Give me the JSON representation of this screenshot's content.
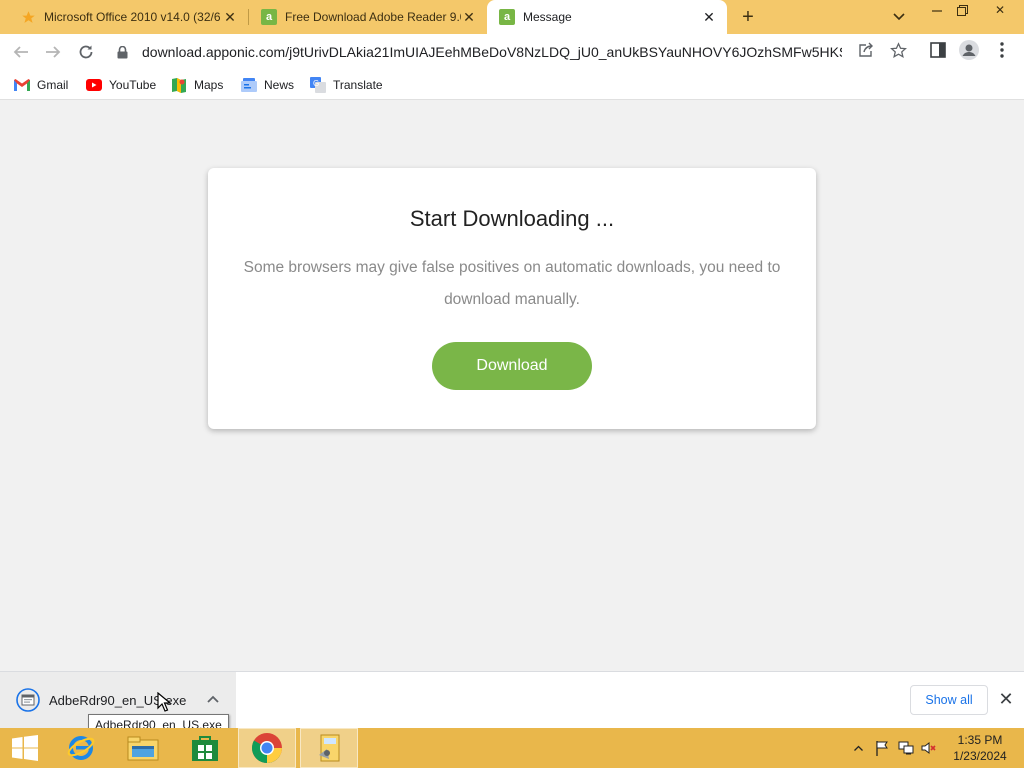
{
  "tabs": [
    {
      "title": "Microsoft Office 2010 v14.0 (32/6",
      "icon": "star-icon"
    },
    {
      "title": "Free Download Adobe Reader 9.0",
      "icon": "apponic-icon"
    },
    {
      "title": "Message",
      "icon": "apponic-icon",
      "active": true
    }
  ],
  "favicon_letter": "a",
  "url": "download.apponic.com/j9tUrivDLAkia21ImUIAJEehMBeDoV8NzLDQ_jU0_anUkBSYauNHOVY6JOzhSMFw5HKSkJ...",
  "bookmarks": [
    {
      "label": "Gmail",
      "icon": "gmail-icon"
    },
    {
      "label": "YouTube",
      "icon": "youtube-icon"
    },
    {
      "label": "Maps",
      "icon": "maps-icon"
    },
    {
      "label": "News",
      "icon": "news-icon"
    },
    {
      "label": "Translate",
      "icon": "translate-icon"
    }
  ],
  "page": {
    "heading": "Start Downloading ...",
    "message": "Some browsers may give false positives on automatic downloads, you need to download manually.",
    "download_label": "Download"
  },
  "download_shelf": {
    "filename": "AdbeRdr90_en_US.exe",
    "tooltip": "AdbeRdr90_en_US.exe",
    "show_all_label": "Show all"
  },
  "taskbar": {
    "time": "1:35 PM",
    "date": "1/23/2024",
    "apps": [
      "start-button",
      "internet-explorer-icon",
      "file-explorer-icon",
      "store-icon",
      "chrome-icon",
      "installer-icon"
    ]
  },
  "colors": {
    "tabstrip": "#f4c86a",
    "taskbar": "#e9b74b",
    "download_button": "#7ab648",
    "show_all_text": "#1a73e8"
  }
}
